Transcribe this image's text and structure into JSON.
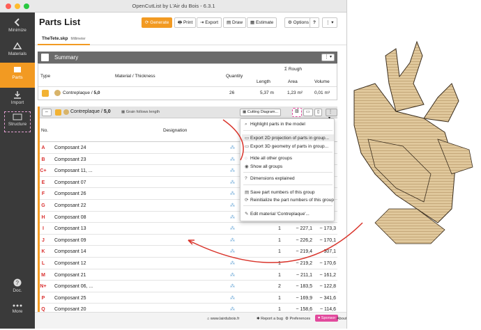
{
  "window": {
    "title": "OpenCutList by L'Air du Bois - 6.3.1"
  },
  "sidebar": {
    "items": [
      {
        "label": "Minimize"
      },
      {
        "label": "Materials"
      },
      {
        "label": "Parts"
      },
      {
        "label": "Import"
      },
      {
        "label": "Structure"
      },
      {
        "label": "Doc."
      },
      {
        "label": "More"
      }
    ]
  },
  "header": {
    "title": "Parts List",
    "generate": "Generate",
    "print": "Print",
    "export": "Export",
    "draw": "Draw",
    "estimate": "Estimate",
    "options": "Options",
    "help": "?"
  },
  "tab": {
    "name": "TheTete.skp",
    "unit": "Millimeter"
  },
  "summary": {
    "title": "Summary",
    "cols": {
      "type": "Type",
      "material": "Material / Thickness",
      "quantity": "Quantity",
      "rough": "Σ Rough",
      "length": "Length",
      "area": "Area",
      "volume": "Volume"
    },
    "row": {
      "material": "Contreplaque",
      "thickness": "5,0",
      "quantity": "26",
      "length": "5,37 m",
      "area": "1,23 m²",
      "volume": "0,01 m³"
    }
  },
  "group": {
    "material": "Contreplaque",
    "thickness": "5,0",
    "grain": "Grain follows length",
    "cutting_btn": "Cutting Diagram...",
    "col_no": "No.",
    "col_designation": "Designation"
  },
  "parts": [
    {
      "id": "A",
      "name": "Composant 24",
      "qty": "",
      "len": "",
      "wid": ""
    },
    {
      "id": "B",
      "name": "Composant 23",
      "qty": "",
      "len": "",
      "wid": ""
    },
    {
      "id": "C+",
      "name": "Composant 11, ...",
      "qty": "",
      "len": "",
      "wid": ""
    },
    {
      "id": "E",
      "name": "Composant 07",
      "qty": "",
      "len": "",
      "wid": ""
    },
    {
      "id": "F",
      "name": "Composant 26",
      "qty": "",
      "len": "",
      "wid": ""
    },
    {
      "id": "G",
      "name": "Composant 22",
      "qty": "",
      "len": "",
      "wid": ""
    },
    {
      "id": "H",
      "name": "Composant 08",
      "qty": "",
      "len": "",
      "wid": ""
    },
    {
      "id": "I",
      "name": "Composant 13",
      "qty": "1",
      "len": "~ 227,1",
      "wid": "~ 173,3"
    },
    {
      "id": "J",
      "name": "Composant 09",
      "qty": "1",
      "len": "~ 226,2",
      "wid": "~ 170,1"
    },
    {
      "id": "K",
      "name": "Composant 14",
      "qty": "1",
      "len": "~ 219,4",
      "wid": "307,1"
    },
    {
      "id": "L",
      "name": "Composant 12",
      "qty": "1",
      "len": "~ 219,2",
      "wid": "~ 170,6"
    },
    {
      "id": "M",
      "name": "Composant 21",
      "qty": "1",
      "len": "~ 211,1",
      "wid": "~ 161,2"
    },
    {
      "id": "N+",
      "name": "Composant 06, ...",
      "qty": "2",
      "len": "~ 183,5",
      "wid": "~ 122,8"
    },
    {
      "id": "P",
      "name": "Composant 25",
      "qty": "1",
      "len": "~ 169,9",
      "wid": "~ 341,6"
    },
    {
      "id": "Q",
      "name": "Composant 20",
      "qty": "1",
      "len": "~ 158,6",
      "wid": "~ 114,6"
    }
  ],
  "menu": {
    "items": [
      "Highlight parts in the model",
      "Export 2D projection of parts in group...",
      "Export 3D geometry of parts in group...",
      "Hide all other groups",
      "Show all groups",
      "Dimensions explained",
      "Save part numbers of this group",
      "Reinitialize the part numbers of this group",
      "Edit material 'Contreplaque'..."
    ]
  },
  "footer": {
    "site": "www.lairdubois.fr",
    "bug": "Report a bug",
    "prefs": "Preferences",
    "sponsor": "Sponsor",
    "about": "About"
  },
  "colors": {
    "accent": "#f29a22",
    "sidebar": "#3a3a3a",
    "letters": "#d93030",
    "arrow": "#d9342b",
    "sponsor": "#e24a9d"
  }
}
